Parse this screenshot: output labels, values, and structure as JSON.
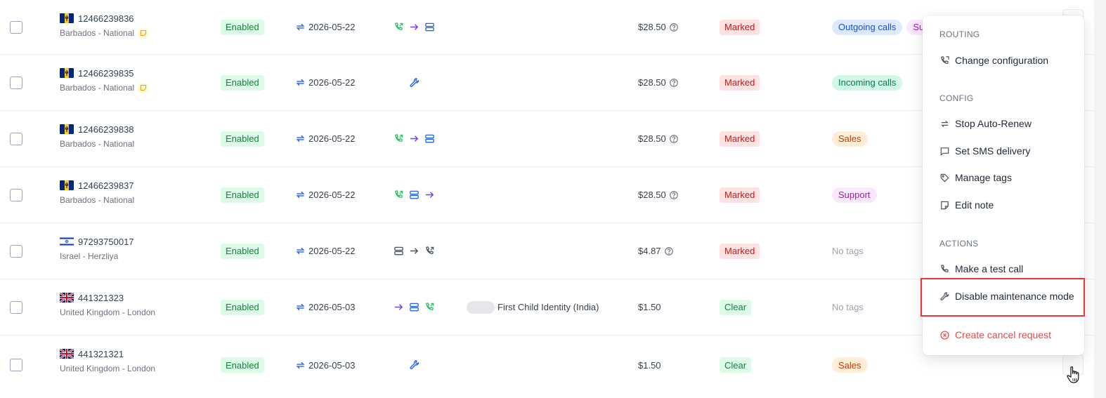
{
  "colors": {
    "enabled_bg": "#dcfce7",
    "enabled_fg": "#15803d",
    "marked_bg": "#fee2e2",
    "marked_fg": "#b91c1c",
    "accent_blue": "#2563eb",
    "green_icon": "#22c55e",
    "purple_arrow": "#7c3aed",
    "danger": "#ef4444",
    "highlight": "#e53935"
  },
  "rows": [
    {
      "number": "12466239836",
      "location": "Barbados - National",
      "flag": "barbados",
      "has_note": true,
      "status": "Enabled",
      "renew_date": "2026-05-22",
      "routing": [
        "phone-icon",
        "arrow-right-icon",
        "server-icon"
      ],
      "identity": "",
      "price": "$28.50",
      "price_help": true,
      "spam": "Marked",
      "tags": [
        {
          "label": "Outgoing calls",
          "style": "blue"
        },
        {
          "label": "Su",
          "style": "pink"
        }
      ],
      "no_tags": ""
    },
    {
      "number": "12466239835",
      "location": "Barbados - National",
      "flag": "barbados",
      "has_note": true,
      "status": "Enabled",
      "renew_date": "2026-05-22",
      "routing": [
        "wrench-icon"
      ],
      "identity": "",
      "price": "$28.50",
      "price_help": true,
      "spam": "Marked",
      "tags": [
        {
          "label": "Incoming calls",
          "style": "teal"
        }
      ],
      "no_tags": ""
    },
    {
      "number": "12466239838",
      "location": "Barbados - National",
      "flag": "barbados",
      "has_note": false,
      "status": "Enabled",
      "renew_date": "2026-05-22",
      "routing": [
        "phone-icon",
        "arrow-right-icon",
        "server-icon"
      ],
      "identity": "",
      "price": "$28.50",
      "price_help": true,
      "spam": "Marked",
      "tags": [
        {
          "label": "Sales",
          "style": "orange"
        }
      ],
      "no_tags": ""
    },
    {
      "number": "12466239837",
      "location": "Barbados - National",
      "flag": "barbados",
      "has_note": false,
      "status": "Enabled",
      "renew_date": "2026-05-22",
      "routing": [
        "phone-icon",
        "server-icon",
        "arrow-right-icon"
      ],
      "identity": "",
      "price": "$28.50",
      "price_help": true,
      "spam": "Marked",
      "tags": [
        {
          "label": "Support",
          "style": "pink"
        }
      ],
      "no_tags": ""
    },
    {
      "number": "97293750017",
      "location": "Israel - Herzliya",
      "flag": "israel",
      "has_note": false,
      "status": "Enabled",
      "renew_date": "2026-05-22",
      "routing": [
        "server-icon-gray",
        "arrow-right-icon-gray",
        "phone-icon-gray"
      ],
      "identity": "",
      "price": "$4.87",
      "price_help": true,
      "spam": "Marked",
      "tags": [],
      "no_tags": "No tags"
    },
    {
      "number": "441321323",
      "location": "United Kingdom - London",
      "flag": "uk",
      "has_note": false,
      "status": "Enabled",
      "renew_date": "2026-05-03",
      "routing": [
        "arrow-right-icon",
        "server-icon",
        "phone-icon"
      ],
      "identity": "First Child Identity (India)",
      "price": "$1.50",
      "price_help": false,
      "spam": "Clear",
      "tags": [],
      "no_tags": "No tags"
    },
    {
      "number": "441321321",
      "location": "United Kingdom - London",
      "flag": "uk",
      "has_note": false,
      "status": "Enabled",
      "renew_date": "2026-05-03",
      "routing": [
        "wrench-icon"
      ],
      "identity": "",
      "price": "$1.50",
      "price_help": false,
      "spam": "Clear",
      "tags": [
        {
          "label": "Sales",
          "style": "orange"
        }
      ],
      "no_tags": ""
    }
  ],
  "menu": {
    "routing_header": "ROUTING",
    "change_configuration": "Change configuration",
    "config_header": "CONFIG",
    "stop_auto_renew": "Stop Auto-Renew",
    "set_sms_delivery": "Set SMS delivery",
    "manage_tags": "Manage tags",
    "edit_note": "Edit note",
    "actions_header": "ACTIONS",
    "make_test_call": "Make a test call",
    "disable_maintenance": "Disable maintenance mode",
    "create_cancel_request": "Create cancel request"
  }
}
